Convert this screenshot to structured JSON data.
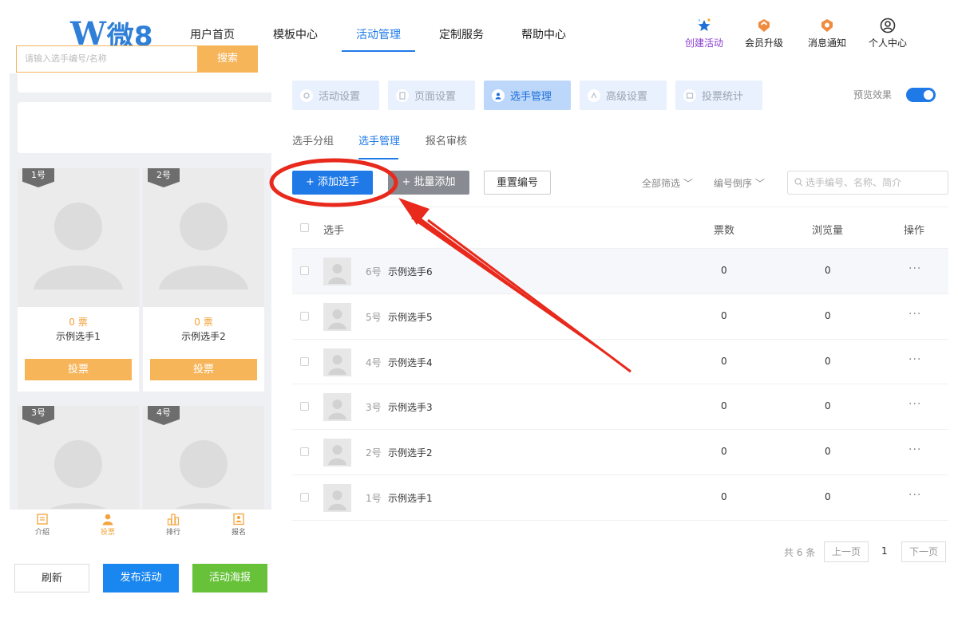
{
  "brand": {
    "logo_text": "微8"
  },
  "nav": {
    "items": [
      "用户首页",
      "模板中心",
      "活动管理",
      "定制服务",
      "帮助中心"
    ],
    "active_index": 2
  },
  "top_actions": {
    "create": "创建活动",
    "upgrade": "会员升级",
    "notify": "消息通知",
    "profile": "个人中心"
  },
  "preview": {
    "search_placeholder": "请输入选手编号/名称",
    "search_button": "搜索",
    "candidates": [
      {
        "tag": "1号",
        "votes": "0 票",
        "name": "示例选手1",
        "vote_button": "投票"
      },
      {
        "tag": "2号",
        "votes": "0 票",
        "name": "示例选手2",
        "vote_button": "投票"
      },
      {
        "tag": "3号"
      },
      {
        "tag": "4号"
      }
    ],
    "tabs": [
      {
        "label": "介绍",
        "icon": "intro-icon"
      },
      {
        "label": "投票",
        "icon": "person-icon"
      },
      {
        "label": "排行",
        "icon": "ranking-icon"
      },
      {
        "label": "报名",
        "icon": "signup-icon"
      }
    ],
    "active_tab": 1
  },
  "bottom_buttons": {
    "refresh": "刷新",
    "publish": "发布活动",
    "poster": "活动海报"
  },
  "settings_tabs": [
    "活动设置",
    "页面设置",
    "选手管理",
    "高级设置",
    "投票统计"
  ],
  "active_settings_tab": 2,
  "preview_toggle": {
    "label": "预览效果",
    "on": true
  },
  "sub_tabs": [
    "选手分组",
    "选手管理",
    "报名审核"
  ],
  "active_sub_tab": 1,
  "toolbar": {
    "add": "+ 添加选手",
    "batch_add": "+ 批量添加",
    "reset_numbers": "重置编号",
    "filter_all": "全部筛选 ﹀",
    "sort": "编号倒序 ﹀",
    "search_placeholder": "选手编号、名称、简介"
  },
  "table": {
    "headers": {
      "player": "选手",
      "votes": "票数",
      "views": "浏览量",
      "actions": "操作"
    },
    "rows": [
      {
        "num": "6号",
        "name": "示例选手6",
        "votes": "0",
        "views": "0",
        "more": "···"
      },
      {
        "num": "5号",
        "name": "示例选手5",
        "votes": "0",
        "views": "0",
        "more": "···"
      },
      {
        "num": "4号",
        "name": "示例选手4",
        "votes": "0",
        "views": "0",
        "more": "···"
      },
      {
        "num": "3号",
        "name": "示例选手3",
        "votes": "0",
        "views": "0",
        "more": "···"
      },
      {
        "num": "2号",
        "name": "示例选手2",
        "votes": "0",
        "views": "0",
        "more": "···"
      },
      {
        "num": "1号",
        "name": "示例选手1",
        "votes": "0",
        "views": "0",
        "more": "···"
      }
    ]
  },
  "pagination": {
    "total": "共 6 条",
    "prev": "上一页",
    "current": "1",
    "next": "下一页"
  },
  "colors": {
    "primary": "#1f7ae8",
    "accent_orange": "#f7b55a",
    "publish_blue": "#1a86f0",
    "poster_green": "#67c23a",
    "annotation_red": "#e8291c"
  }
}
